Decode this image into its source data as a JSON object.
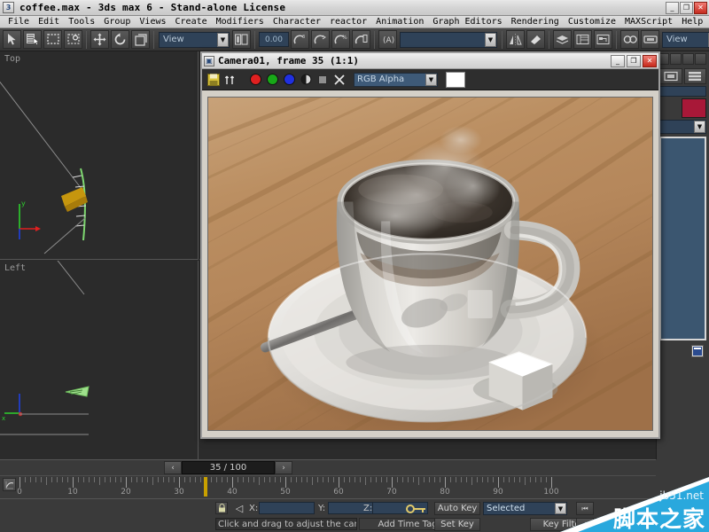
{
  "window": {
    "title": "coffee.max - 3ds max 6 - Stand-alone License",
    "app_icon": "max-app-icon",
    "minimize_label": "_",
    "maximize_label": "❐",
    "close_label": "✕"
  },
  "menubar": {
    "items": [
      {
        "label": "File"
      },
      {
        "label": "Edit"
      },
      {
        "label": "Tools"
      },
      {
        "label": "Group"
      },
      {
        "label": "Views"
      },
      {
        "label": "Create"
      },
      {
        "label": "Modifiers"
      },
      {
        "label": "Character"
      },
      {
        "label": "reactor"
      },
      {
        "label": "Animation"
      },
      {
        "label": "Graph Editors"
      },
      {
        "label": "Rendering"
      },
      {
        "label": "Customize"
      },
      {
        "label": "MAXScript"
      },
      {
        "label": "Help"
      }
    ]
  },
  "toolbar": {
    "reference_coordinate_system": "View",
    "render_viewport_label": "View",
    "angle_snap_value": "0.00",
    "named_selection_sets_value": "",
    "buttons": [
      {
        "name": "undo-button",
        "glyph": "↶"
      },
      {
        "name": "select-object-button",
        "glyph": "➤"
      },
      {
        "name": "select-by-name-button",
        "glyph": "≣"
      },
      {
        "name": "rectangular-selection-region-button",
        "glyph": "⬚"
      },
      {
        "name": "crossing-selection-button",
        "glyph": "◌"
      },
      {
        "name": "select-and-move-button",
        "glyph": "✥"
      },
      {
        "name": "select-and-rotate-button",
        "glyph": "↺"
      },
      {
        "name": "select-and-scale-button",
        "glyph": "◱"
      },
      {
        "name": "mirror-button",
        "glyph": "⬌"
      },
      {
        "name": "align-button",
        "glyph": "▤"
      },
      {
        "name": "layer-manager-button",
        "glyph": "☰"
      },
      {
        "name": "curve-editor-button",
        "glyph": "☷"
      },
      {
        "name": "schematic-view-button",
        "glyph": "⊞"
      },
      {
        "name": "material-editor-button",
        "glyph": "●●"
      },
      {
        "name": "render-scene-button",
        "glyph": "☐"
      },
      {
        "name": "quick-render-button",
        "glyph": "☕"
      }
    ]
  },
  "viewports": [
    {
      "name": "viewport-top",
      "label": "Top"
    },
    {
      "name": "viewport-left",
      "label": "Left"
    },
    {
      "name": "viewport-front",
      "label": ""
    },
    {
      "name": "viewport-camera",
      "label": ""
    }
  ],
  "command_panel": {
    "tabs": [
      "create-tab",
      "modify-tab",
      "hierarchy-tab",
      "motion-tab",
      "display-tab",
      "utilities-tab"
    ],
    "color_swatch": "#a81838",
    "list_background": "#3b5670"
  },
  "render_window": {
    "title": "Camera01, frame 35 (1:1)",
    "icon": "render-frame-icon",
    "minimize_label": "_",
    "maximize_label": "❐",
    "close_label": "✕",
    "toolbar": {
      "save_icon": "save-bitmap-icon",
      "clone_icon": "clone-rendered-frame-icon",
      "red_channel": "#e02020",
      "green_channel": "#18a818",
      "blue_channel": "#2030e0",
      "alpha_icon": "alpha-channel-icon",
      "mono_icon": "monochrome-icon",
      "clear_icon": "clear-icon",
      "channel_select_value": "RGB Alpha",
      "color_swatch": "#ffffff"
    },
    "rendered_image": {
      "subject": "coffee cup on saucer with spoon and sugar cube on wooden table",
      "table_color": "#c08f63",
      "cup_color": "#d8d5cf",
      "coffee_color": "#3a332d"
    }
  },
  "time_slider": {
    "prev_frame_label": "‹",
    "next_frame_label": "›",
    "current_label": "35 / 100",
    "current_frame": 35,
    "total_frames": 100
  },
  "track_bar": {
    "open_mini_curve_editor_icon": "mini-curve-editor-icon",
    "tick_labels": [
      0,
      10,
      20,
      30,
      40,
      50,
      60,
      70,
      80,
      90,
      100
    ],
    "range_start": 0,
    "range_end": 100,
    "cursor_frame": 35
  },
  "status_bar": {
    "lock_selection_icon": "lock-selection-icon",
    "x_label": "X:",
    "y_label": "Y:",
    "z_label": "Z:",
    "x_value": "",
    "y_value": "",
    "z_value": "",
    "key_mode_icon": "key-mode-icon",
    "prompt": "Click and drag to adjust the camera",
    "add_time_tag": "Add Time Tag",
    "auto_key": "Auto Key",
    "set_key": "Set Key",
    "key_filters": "Key Filters...",
    "key_selection_value": "Selected",
    "nav_buttons": [
      {
        "name": "go-to-start-button",
        "glyph": "⏮"
      },
      {
        "name": "previous-frame-button",
        "glyph": "⏴"
      }
    ]
  },
  "watermark": {
    "url": "jb51.net",
    "name": "脚本之家",
    "accent": "#29a8dd"
  }
}
